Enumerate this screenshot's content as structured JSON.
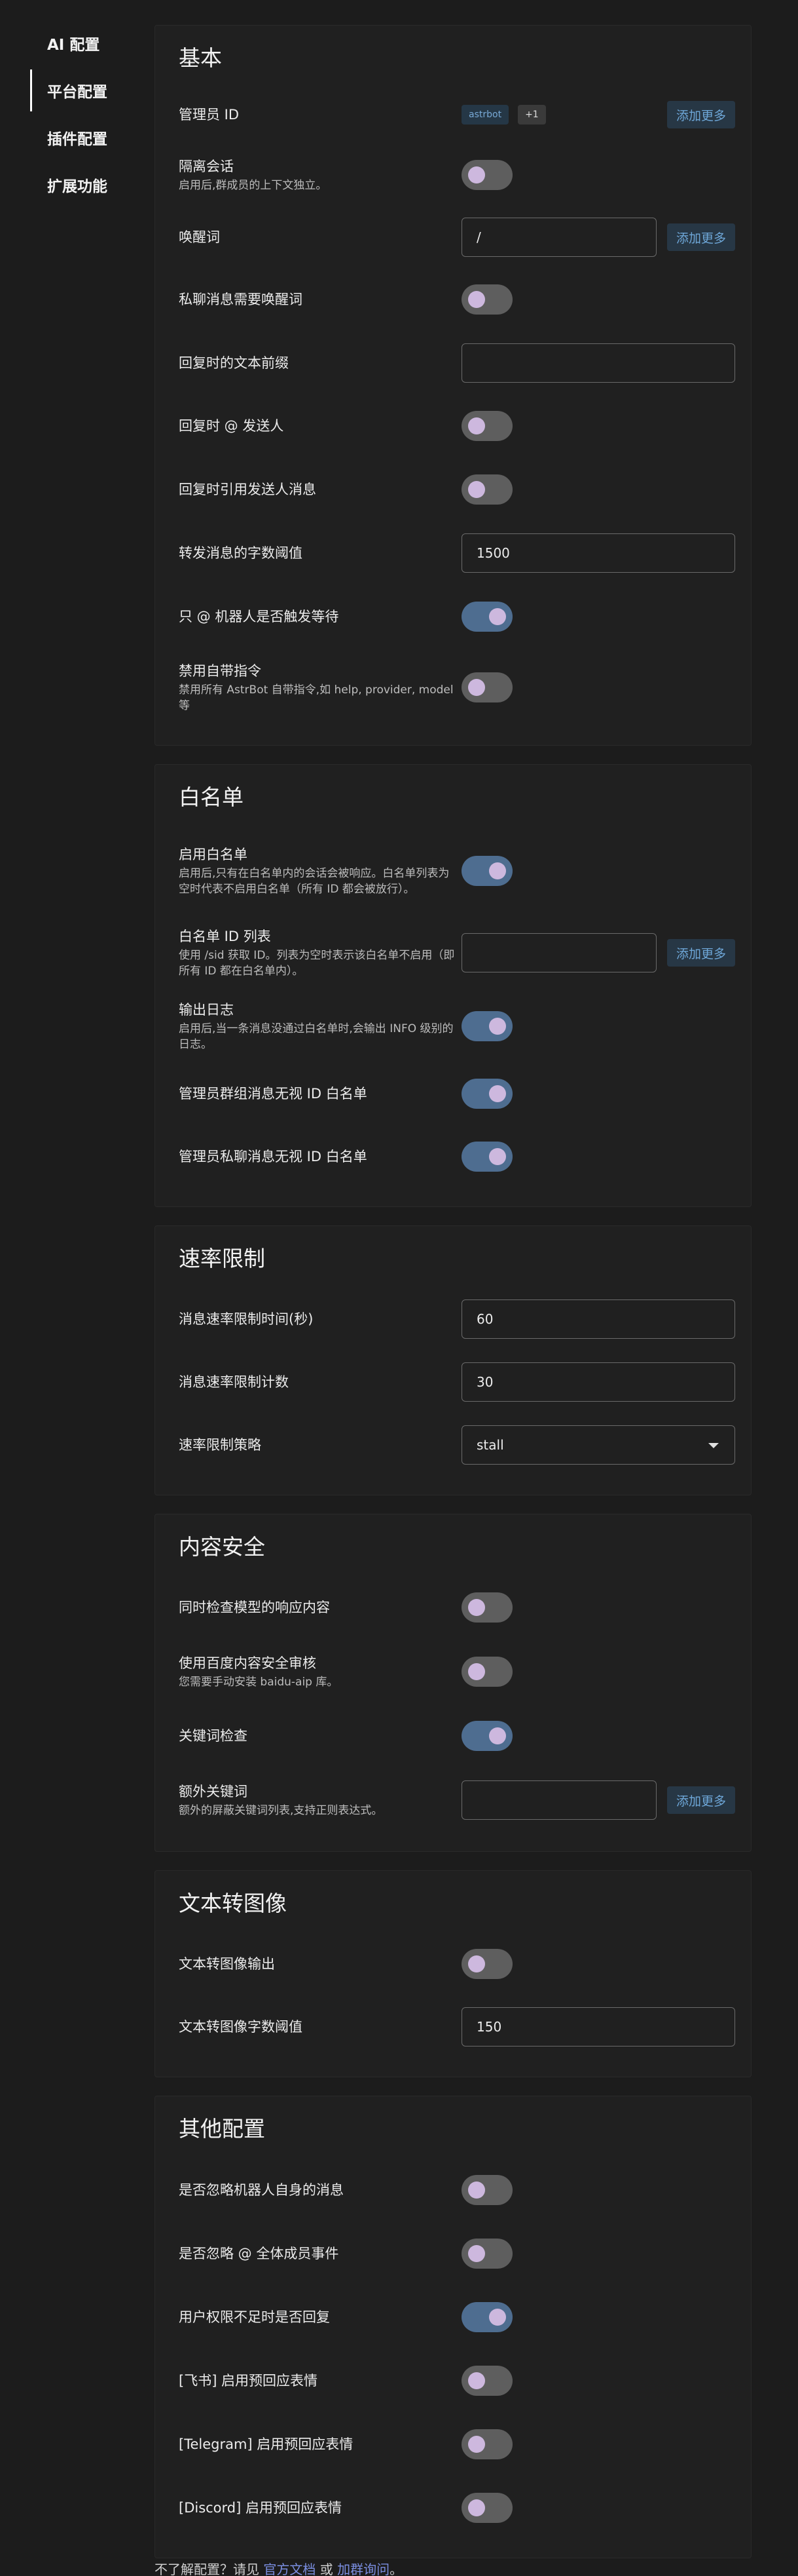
{
  "nav": [
    {
      "label": "AI 配置",
      "active": false
    },
    {
      "label": "平台配置",
      "active": true
    },
    {
      "label": "插件配置",
      "active": false
    },
    {
      "label": "扩展功能",
      "active": false
    }
  ],
  "sections": {
    "basic": {
      "title": "基本",
      "admin_id": {
        "label": "管理员 ID",
        "chips": [
          "astrbot",
          "+1"
        ],
        "add": "添加更多"
      },
      "isolate": {
        "label": "隔离会话",
        "desc": "启用后,群成员的上下文独立。",
        "on": false
      },
      "wake": {
        "label": "唤醒词",
        "value": "/",
        "add": "添加更多"
      },
      "private_wake": {
        "label": "私聊消息需要唤醒词",
        "on": false
      },
      "reply_prefix": {
        "label": "回复时的文本前缀",
        "value": ""
      },
      "reply_at": {
        "label": "回复时 @ 发送人",
        "on": false
      },
      "reply_quote": {
        "label": "回复时引用发送人消息",
        "on": false
      },
      "forward_threshold": {
        "label": "转发消息的字数阈值",
        "value": "1500"
      },
      "only_at_wait": {
        "label": "只 @ 机器人是否触发等待",
        "on": true
      },
      "disable_builtin": {
        "label": "禁用自带指令",
        "desc": "禁用所有 AstrBot 自带指令,如 help, provider, model 等",
        "on": false
      }
    },
    "whitelist": {
      "title": "白名单",
      "enable": {
        "label": "启用白名单",
        "desc": "启用后,只有在白名单内的会话会被响应。白名单列表为空时代表不启用白名单（所有 ID 都会被放行）。",
        "on": true
      },
      "list": {
        "label": "白名单 ID 列表",
        "desc": "使用 /sid 获取 ID。列表为空时表示该白名单不启用（即所有 ID 都在白名单内）。",
        "value": "",
        "add": "添加更多"
      },
      "log": {
        "label": "输出日志",
        "desc": "启用后,当一条消息没通过白名单时,会输出 INFO 级别的日志。",
        "on": true
      },
      "admin_group": {
        "label": "管理员群组消息无视 ID 白名单",
        "on": true
      },
      "admin_private": {
        "label": "管理员私聊消息无视 ID 白名单",
        "on": true
      }
    },
    "ratelimit": {
      "title": "速率限制",
      "time": {
        "label": "消息速率限制时间(秒)",
        "value": "60"
      },
      "count": {
        "label": "消息速率限制计数",
        "value": "30"
      },
      "strategy": {
        "label": "速率限制策略",
        "value": "stall"
      }
    },
    "safety": {
      "title": "内容安全",
      "check_model": {
        "label": "同时检查模型的响应内容",
        "on": false
      },
      "baidu": {
        "label": "使用百度内容安全审核",
        "desc": "您需要手动安装 baidu-aip 库。",
        "on": false
      },
      "keyword": {
        "label": "关键词检查",
        "on": true
      },
      "extra": {
        "label": "额外关键词",
        "desc": "额外的屏蔽关键词列表,支持正则表达式。",
        "value": "",
        "add": "添加更多"
      }
    },
    "t2i": {
      "title": "文本转图像",
      "output": {
        "label": "文本转图像输出",
        "on": false
      },
      "threshold": {
        "label": "文本转图像字数阈值",
        "value": "150"
      }
    },
    "other": {
      "title": "其他配置",
      "ignore_self": {
        "label": "是否忽略机器人自身的消息",
        "on": false
      },
      "ignore_all": {
        "label": "是否忽略 @ 全体成员事件",
        "on": false
      },
      "no_perm_reply": {
        "label": "用户权限不足时是否回复",
        "on": true
      },
      "feishu": {
        "label": "[飞书] 启用预回应表情",
        "on": false
      },
      "telegram": {
        "label": "[Telegram] 启用预回应表情",
        "on": false
      },
      "discord": {
        "label": "[Discord] 启用预回应表情",
        "on": false
      }
    }
  },
  "footer": {
    "prefix": "不了解配置？请见 ",
    "doc_link": "官方文档",
    "middle": " 或 ",
    "group_link": "加群询问",
    "suffix": "。"
  },
  "colors": {
    "toggle_on": "#4e6d90",
    "toggle_off": "#5e5e5e",
    "knob": "#cdb8de",
    "link": "#7a8ee0",
    "add_button": "#6ea7d8"
  }
}
